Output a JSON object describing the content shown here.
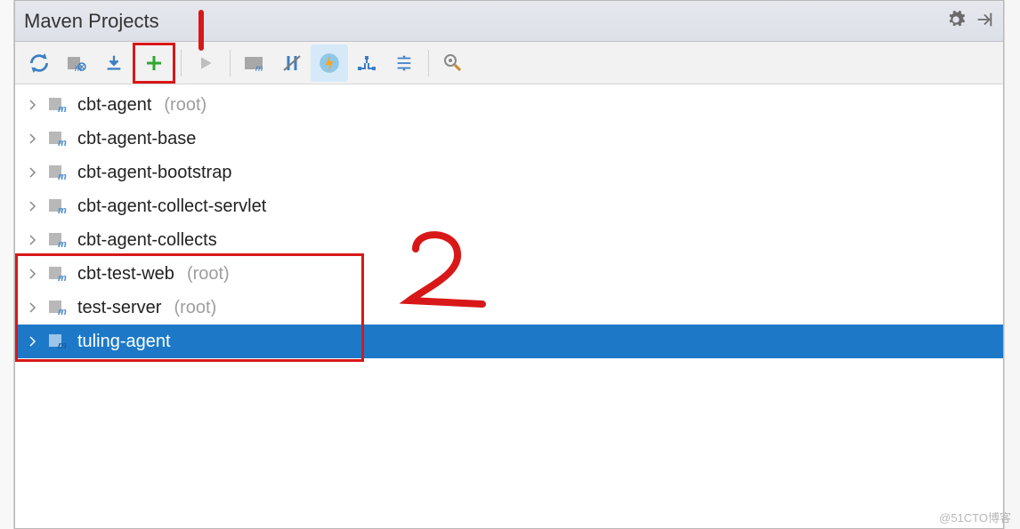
{
  "panel": {
    "title": "Maven Projects"
  },
  "toolbar": {
    "buttons": [
      "refresh",
      "generate",
      "download",
      "add",
      "run",
      "toggle-offline",
      "skip-tests",
      "profile",
      "show-deps-graph",
      "collapse-all",
      "settings"
    ]
  },
  "tree": {
    "items": [
      {
        "name": "cbt-agent",
        "suffix": "(root)",
        "selected": false
      },
      {
        "name": "cbt-agent-base",
        "suffix": "",
        "selected": false
      },
      {
        "name": "cbt-agent-bootstrap",
        "suffix": "",
        "selected": false
      },
      {
        "name": "cbt-agent-collect-servlet",
        "suffix": "",
        "selected": false
      },
      {
        "name": "cbt-agent-collects",
        "suffix": "",
        "selected": false
      },
      {
        "name": "cbt-test-web",
        "suffix": "(root)",
        "selected": false
      },
      {
        "name": "test-server",
        "suffix": "(root)",
        "selected": false
      },
      {
        "name": "tuling-agent",
        "suffix": "",
        "selected": true
      }
    ]
  },
  "annotations": {
    "marker1": "|",
    "marker2": "2"
  },
  "watermark": "@51CTO博客"
}
